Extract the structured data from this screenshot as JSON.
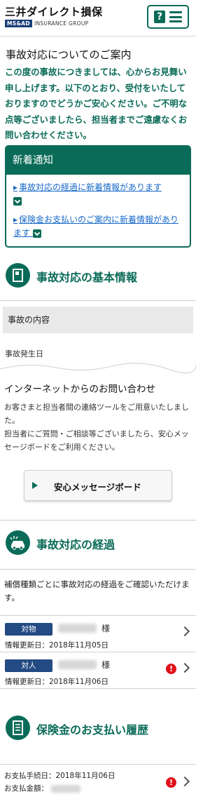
{
  "header": {
    "logo_main": "三井ダイレクト損保",
    "logo_badge": "MS&AD",
    "logo_group": "INSURANCE GROUP",
    "help_glyph": "?",
    "accent_color": "#0a6b58"
  },
  "intro": {
    "title": "事故対応についてのご案内",
    "text": "この度の事故につきましては、心からお見舞い申し上げます。以下のとおり、受付をいたしておりますのでどうかご安心ください。ご不明な点等ございましたら、担当者までご遠慮なくお問い合わせください。"
  },
  "notice": {
    "title": "新着通知",
    "items": [
      {
        "label": "事故対応の経過に新着情報があります"
      },
      {
        "label": "保険金お支払いのご案内に新着情報があります"
      }
    ]
  },
  "basic_info": {
    "title": "事故対応の基本情報",
    "band": "事故の内容",
    "date_label": "事故発生日"
  },
  "inquiry": {
    "title": "インターネットからのお問い合わせ",
    "text1": "お客さまと担当者間の連絡ツールをご用意いたしました。",
    "text2": "担当者にご質問・ご相談等ございましたら、安心メッセージボードをご利用ください。",
    "button_label": "安心メッセージボード"
  },
  "progress": {
    "title": "事故対応の経過",
    "text": "補償種類ごとに事故対応の経過をご確認いただけます。",
    "rows": [
      {
        "badge": "対物",
        "suffix": "様",
        "updated": "情報更新日：2018年11月05日",
        "alert": false
      },
      {
        "badge": "対人",
        "suffix": "様",
        "updated": "情報更新日：2018年11月06日",
        "alert": true
      }
    ],
    "alert_glyph": "!"
  },
  "payment": {
    "title": "保険金のお支払い履歴",
    "line1": "お支払手続日：2018年11月06日",
    "line2": "お支払金額："
  }
}
